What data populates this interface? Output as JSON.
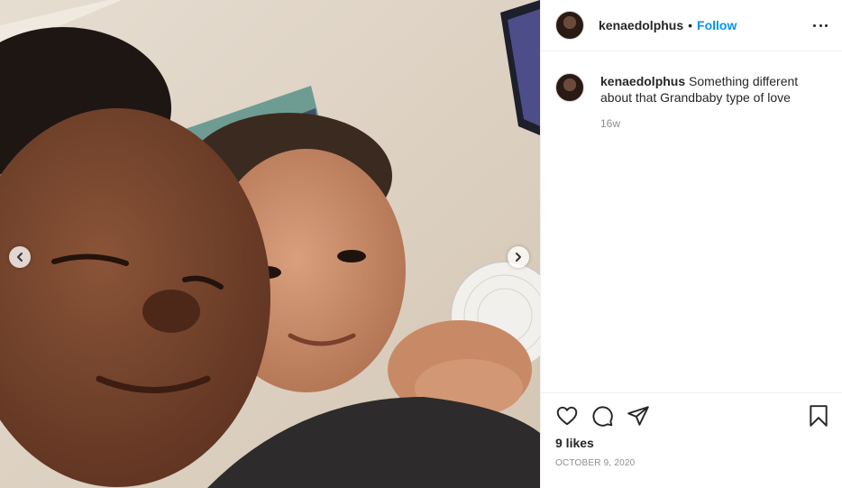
{
  "post": {
    "username": "kenaedolphus",
    "separator": "•",
    "follow_label": "Follow",
    "caption": {
      "username": "kenaedolphus",
      "text": "Something different about that Grandbaby type of love",
      "age": "16w"
    },
    "likes": "9 likes",
    "date": "OCTOBER 9, 2020"
  },
  "icons": {
    "prev": "chevron-left-icon",
    "next": "chevron-right-icon",
    "more": "more-options-icon",
    "like": "heart-icon",
    "comment": "comment-icon",
    "share": "paper-plane-icon",
    "save": "bookmark-icon"
  },
  "colors": {
    "accent": "#0095f6",
    "text": "#262626",
    "muted": "#8e8e8e",
    "border": "#efefef"
  }
}
